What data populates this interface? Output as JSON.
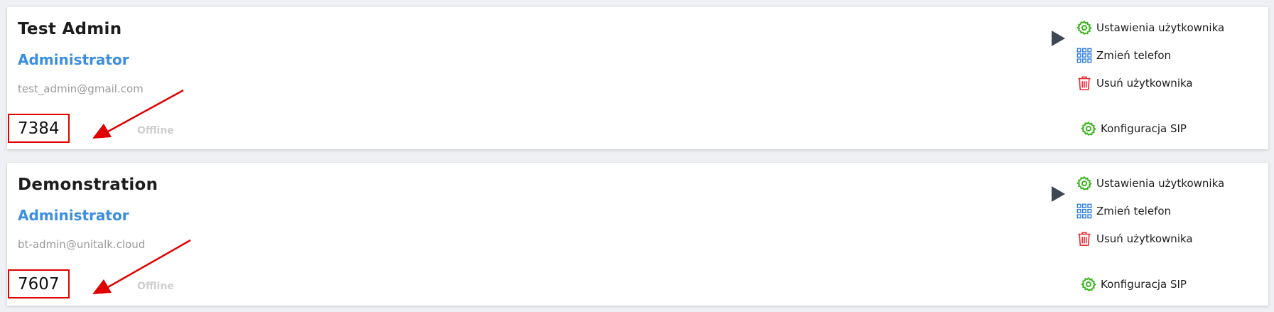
{
  "users": [
    {
      "name": "Test Admin",
      "role": "Administrator",
      "email": "test_admin@gmail.com",
      "extension": "7384",
      "status": "Offline"
    },
    {
      "name": "Demonstration",
      "role": "Administrator",
      "email": "bt-admin@unitalk.cloud",
      "extension": "7607",
      "status": "Offline"
    }
  ],
  "actions": {
    "user_settings": "Ustawienia użytkownika",
    "change_phone": "Zmień telefon",
    "delete_user": "Usuń użytkownika",
    "sip_config": "Konfiguracja SIP"
  },
  "icons": {
    "settings": "gear-icon",
    "phone": "keypad-grid-icon",
    "delete": "trash-icon",
    "play": "play-icon",
    "annotation": "red-arrow-annotation"
  },
  "colors": {
    "role": "#3a8fe0",
    "settings_icon": "#3cb521",
    "keypad_icon": "#2f7fe0",
    "trash_icon": "#e8343a",
    "highlight": "#e00000",
    "status_offline": "#cfcfcf"
  }
}
